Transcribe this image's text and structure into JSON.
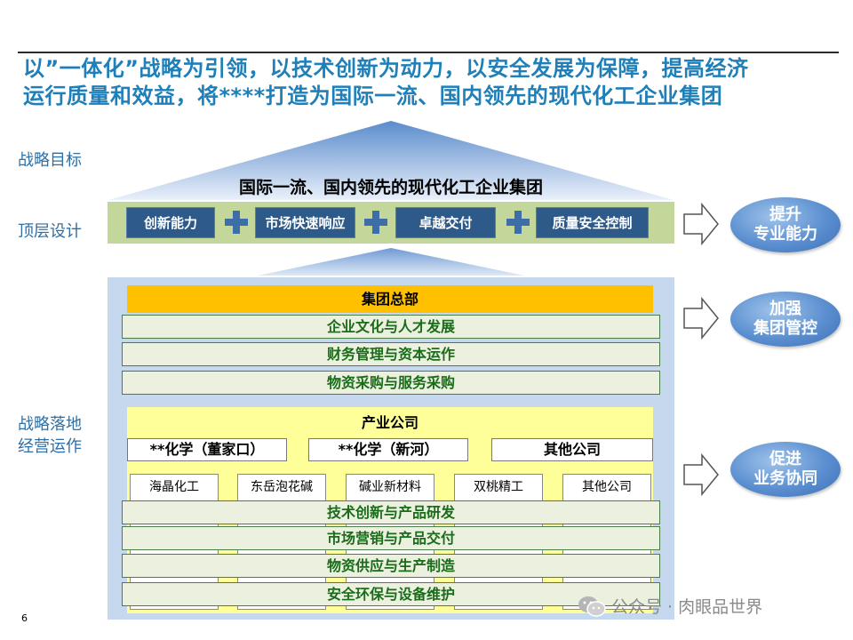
{
  "headline": {
    "line1": "以”一体化”战略为引领，以技术创新为动力，以安全发展为保障，提高经济",
    "line2": "运行质量和效益，将****打造为国际一流、国内领先的现代化工企业集团"
  },
  "side_labels": {
    "goal": "战略目标",
    "top_design": "顶层设计",
    "landing_1": "战略落地",
    "landing_2": "经营运作"
  },
  "goal_text": "国际一流、国内领先的现代化工企业集团",
  "capabilities": [
    "创新能力",
    "市场快速响应",
    "卓越交付",
    "质量安全控制"
  ],
  "headquarters": {
    "title": "集团总部",
    "functions": [
      "企业文化与人才发展",
      "财务管理与资本运作",
      "物资采购与服务采购"
    ]
  },
  "industry": {
    "title": "产业公司",
    "companies": [
      "**化学（董家口）",
      "**化学（新河）",
      "其他公司"
    ],
    "subsidiaries": [
      "海晶化工",
      "东岳泡花碱",
      "碱业新材料",
      "双桃精工",
      "其他公司"
    ],
    "functions": [
      "技术创新与产品研发",
      "市场营销与产品交付",
      "物资供应与生产制造",
      "安全环保与设备维护"
    ]
  },
  "outcomes": [
    {
      "line1": "提升",
      "line2": "专业能力"
    },
    {
      "line1": "加强",
      "line2": "集团管控"
    },
    {
      "line1": "促进",
      "line2": "业务协同"
    }
  ],
  "page_number": "6",
  "watermark": "公众号 · 肉眼品世界",
  "colors": {
    "headline": "#1f7fb8",
    "capability_box": "#2e5a8a",
    "band_green": "#c4d79b",
    "hq_orange": "#ffc000",
    "industry_yellow": "#ffff99",
    "panel_blue": "#c5d8ee",
    "function_text_green": "#1a6b1a"
  }
}
